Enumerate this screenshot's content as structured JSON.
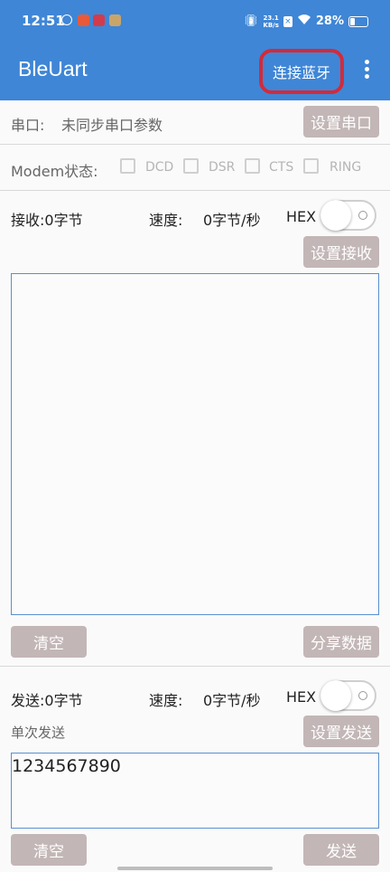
{
  "status_bar": {
    "time": "12:51",
    "speed_top": "23.1",
    "speed_bottom": "KB/s",
    "battery": "28%"
  },
  "appbar": {
    "title": "BleUart",
    "connect_button": "连接蓝牙"
  },
  "serial": {
    "label": "串口:",
    "value": "未同步串口参数",
    "button": "设置串口"
  },
  "modem": {
    "label": "Modem状态:",
    "signals": [
      "DCD",
      "DSR",
      "CTS",
      "RING"
    ]
  },
  "receive": {
    "count_label": "接收:0字节",
    "speed_label": "速度:",
    "speed_value": "0字节/秒",
    "hex_label": "HEX",
    "setting_button": "设置接收",
    "text": "",
    "clear_button": "清空",
    "share_button": "分享数据"
  },
  "send": {
    "count_label": "发送:0字节",
    "speed_label": "速度:",
    "speed_value": "0字节/秒",
    "hex_label": "HEX",
    "mode_label": "单次发送",
    "setting_button": "设置发送",
    "text": "1234567890",
    "clear_button": "清空",
    "send_button": "发送"
  }
}
